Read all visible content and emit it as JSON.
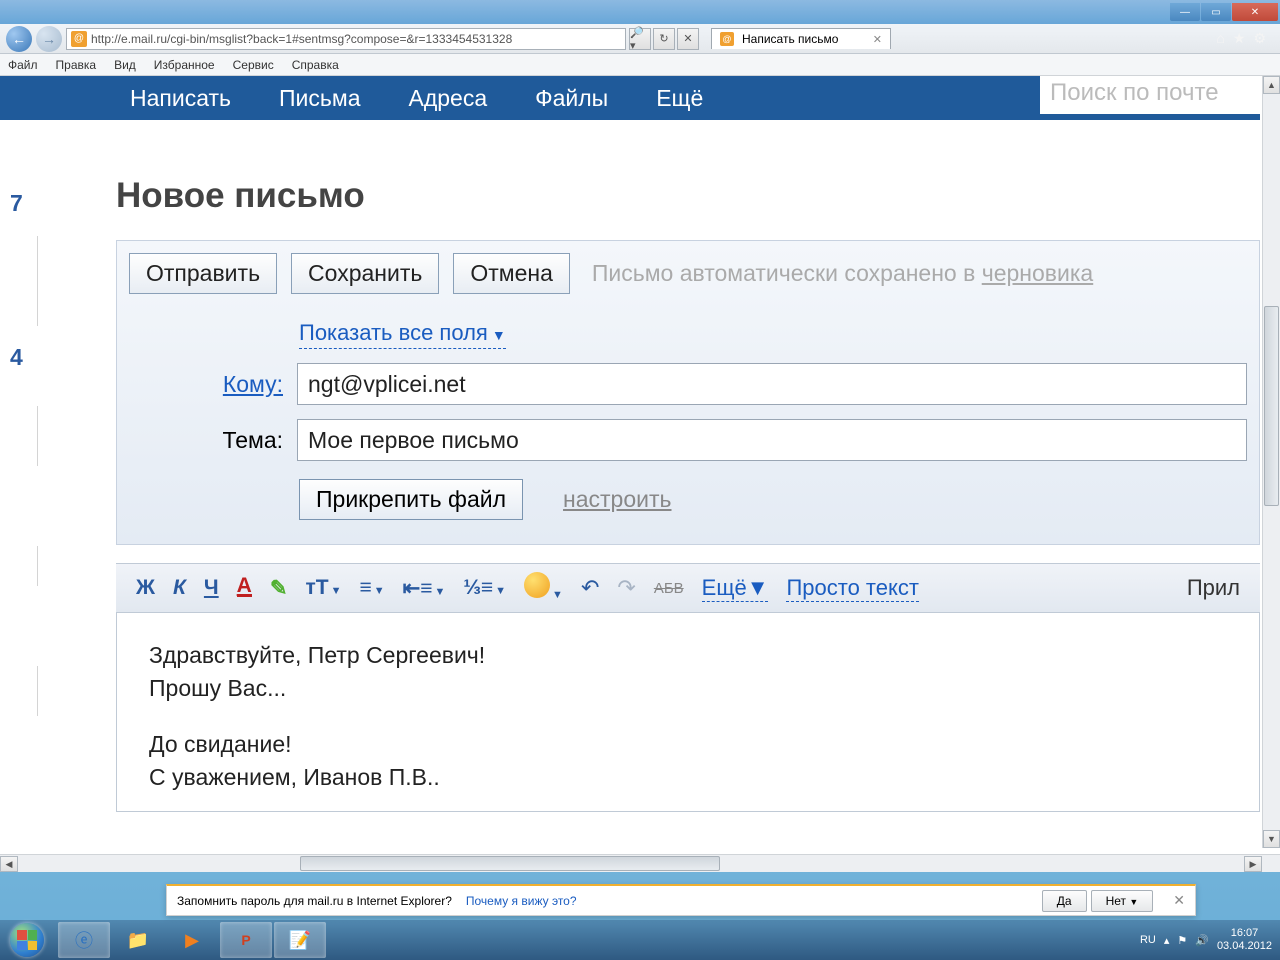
{
  "window_controls": {
    "min": "—",
    "max": "▭",
    "close": "✕"
  },
  "ie": {
    "url": "http://e.mail.ru/cgi-bin/msglist?back=1#sentmsg?compose=&r=1333454531328",
    "search_hint": "🔎 ▾",
    "refresh": "↻",
    "stop": "✕",
    "tab_title": "Написать письмо",
    "menu": [
      "Файл",
      "Правка",
      "Вид",
      "Избранное",
      "Сервис",
      "Справка"
    ],
    "tools": [
      "⌂",
      "★",
      "⚙"
    ]
  },
  "mail_nav": [
    "Написать",
    "Письма",
    "Адреса",
    "Файлы",
    "Ещё"
  ],
  "search_placeholder": "Поиск по почте",
  "left_numbers": {
    "a": "7",
    "b": "4"
  },
  "compose": {
    "title": "Новое письмо",
    "send": "Отправить",
    "save": "Сохранить",
    "cancel": "Отмена",
    "autosave": "Письмо автоматически сохранено в ",
    "autosave_link": "черновика",
    "show_fields": "Показать все поля",
    "to_label": "Кому:",
    "to_value": "ngt@vplicei.net",
    "subject_label": "Тема:",
    "subject_value": "Мое первое письмо",
    "attach": "Прикрепить файл",
    "configure": "настроить"
  },
  "toolbar": {
    "bold": "Ж",
    "italic": "К",
    "underline": "Ч",
    "color": "А",
    "highlight": "✎",
    "size": "тТ",
    "align": "≡",
    "indent": "⇤≡",
    "list": "⅓≡",
    "undo": "↶",
    "redo": "↷",
    "abc": "АБВ",
    "more": "Ещё",
    "plain": "Просто текст",
    "attach_right": "Прил"
  },
  "body": {
    "line1": "Здравствуйте, Петр Сергеевич!",
    "line2": "Прошу Вас...",
    "line3": "До свидание!",
    "line4": "С уважением, Иванов П.В.."
  },
  "pw_bar": {
    "text": "Запомнить пароль для mail.ru в Internet Explorer?",
    "why": "Почему я вижу это?",
    "yes": "Да",
    "no": "Нет"
  },
  "tray": {
    "lang": "RU",
    "time": "16:07",
    "date": "03.04.2012"
  }
}
